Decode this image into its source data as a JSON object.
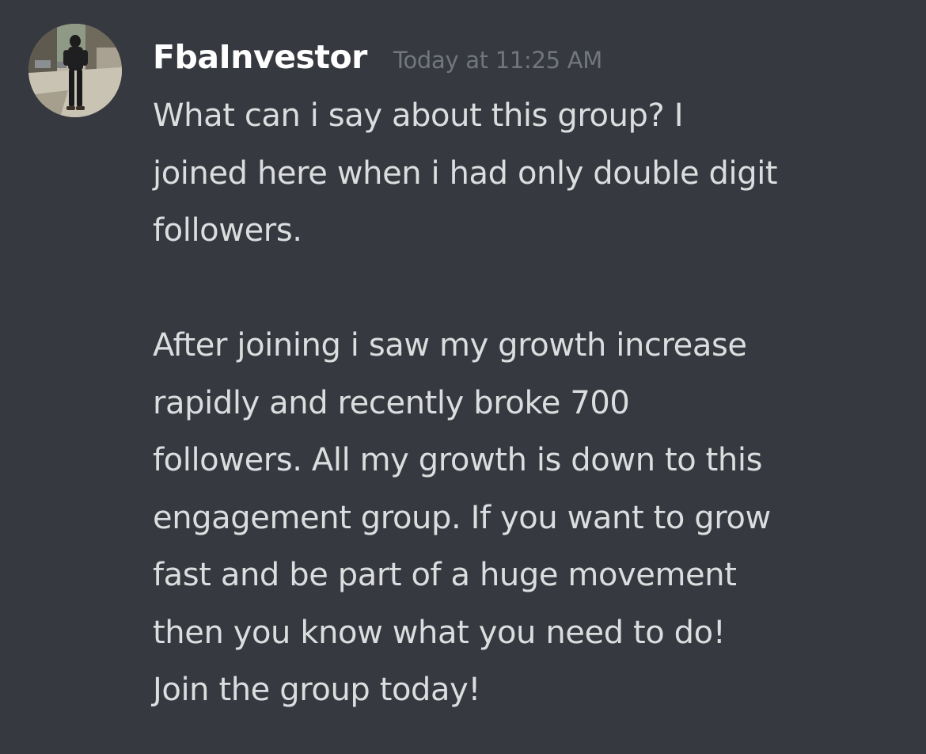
{
  "message": {
    "username": "FbaInvestor",
    "timestamp": "Today at 11:25 AM",
    "avatar_icon": "user-avatar-photo",
    "paragraphs": [
      {
        "lines": [
          "What can i say about this group? I",
          "joined here when i had only double digit",
          "followers."
        ]
      },
      {
        "lines": [
          "After joining i saw my growth increase",
          "rapidly and recently broke 700",
          "followers. All my growth is down to this",
          "engagement group. If you want to grow",
          "fast and be part of a huge movement",
          "then you know what you need to do!",
          "Join the group today!"
        ]
      }
    ]
  },
  "colors": {
    "background": "#36393f",
    "username": "#ffffff",
    "timestamp": "#72767d",
    "message_text": "#dcddde"
  }
}
